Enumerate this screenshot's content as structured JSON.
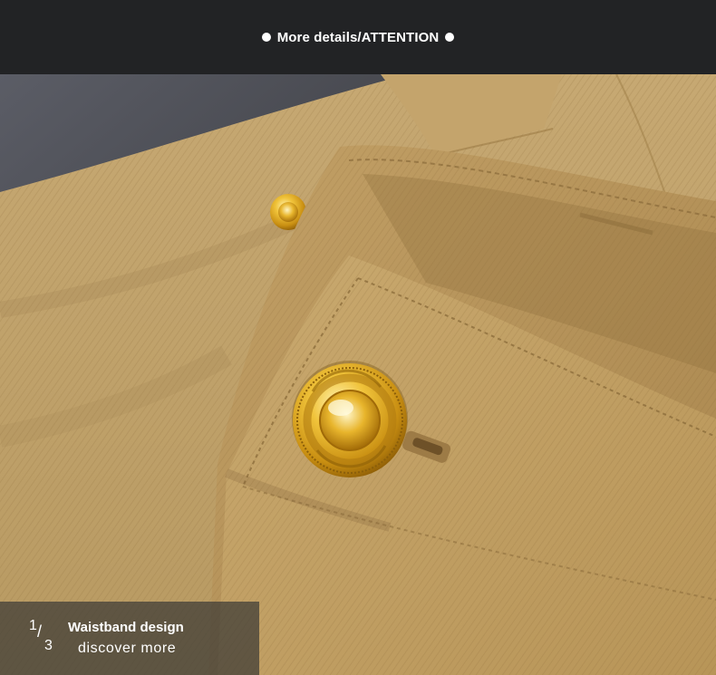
{
  "header": {
    "title": "More details/ATTENTION"
  },
  "caption": {
    "index_numerator": "1",
    "index_slash": "/",
    "index_denominator": "3",
    "title": "Waistband design",
    "subtitle": "discover more"
  },
  "colors": {
    "header_bg": "#222325",
    "fabric_khaki": "#c3a26a",
    "button_gold": "#d9a824",
    "caption_overlay": "#3c3a36"
  },
  "icons": {
    "header_left": "dot-icon",
    "header_right": "dot-icon"
  }
}
